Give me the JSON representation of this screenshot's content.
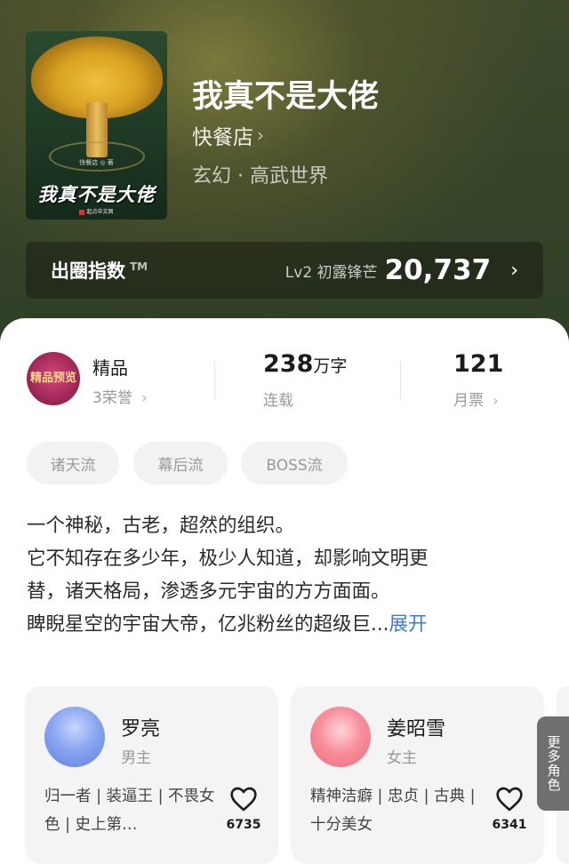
{
  "book": {
    "title": "我真不是大佬",
    "author": "快餐店",
    "genre": "玄幻 · 高武世界",
    "cover": {
      "title_art": "我真不是大佬",
      "author_line": "快餐店 ◎ 著",
      "publisher": "起点中文网"
    }
  },
  "influence_index": {
    "label": "出圈指数",
    "trademark": "TM",
    "level": "Lv2 初露锋芒",
    "value": "20,737"
  },
  "stats": {
    "badge": {
      "art_text": "精品预览",
      "title": "精品",
      "subtitle": "3荣誉"
    },
    "words": {
      "value": "238",
      "unit": "万字",
      "label": "连载"
    },
    "monthly_votes": {
      "value": "121",
      "label": "月票"
    }
  },
  "tags": [
    "诸天流",
    "幕后流",
    "BOSS流"
  ],
  "description": {
    "lines": [
      " 一个神秘，古老，超然的组织。",
      "它不知存在多少年，极少人知道，却影响文明更",
      "替，诸天格局，渗透多元宇宙的方方面面。",
      "睥睨星空的宇宙大帝，亿兆粉丝的超级巨..."
    ],
    "expand": "展开"
  },
  "characters": [
    {
      "name": "罗亮",
      "role": "男主",
      "tags": "归一者 | 装逼王 | 不畏女色 | 史上第…",
      "likes": "6735",
      "avatar_color": "#6f8fe8"
    },
    {
      "name": "姜昭雪",
      "role": "女主",
      "tags": "精神洁癖 | 忠贞 | 古典 | 十分美女",
      "likes": "6341",
      "avatar_color": "#f06a7c"
    }
  ],
  "more_roles": "更多角色",
  "colors": {
    "accent": "#3d7bd4",
    "badge": "#a02858"
  }
}
